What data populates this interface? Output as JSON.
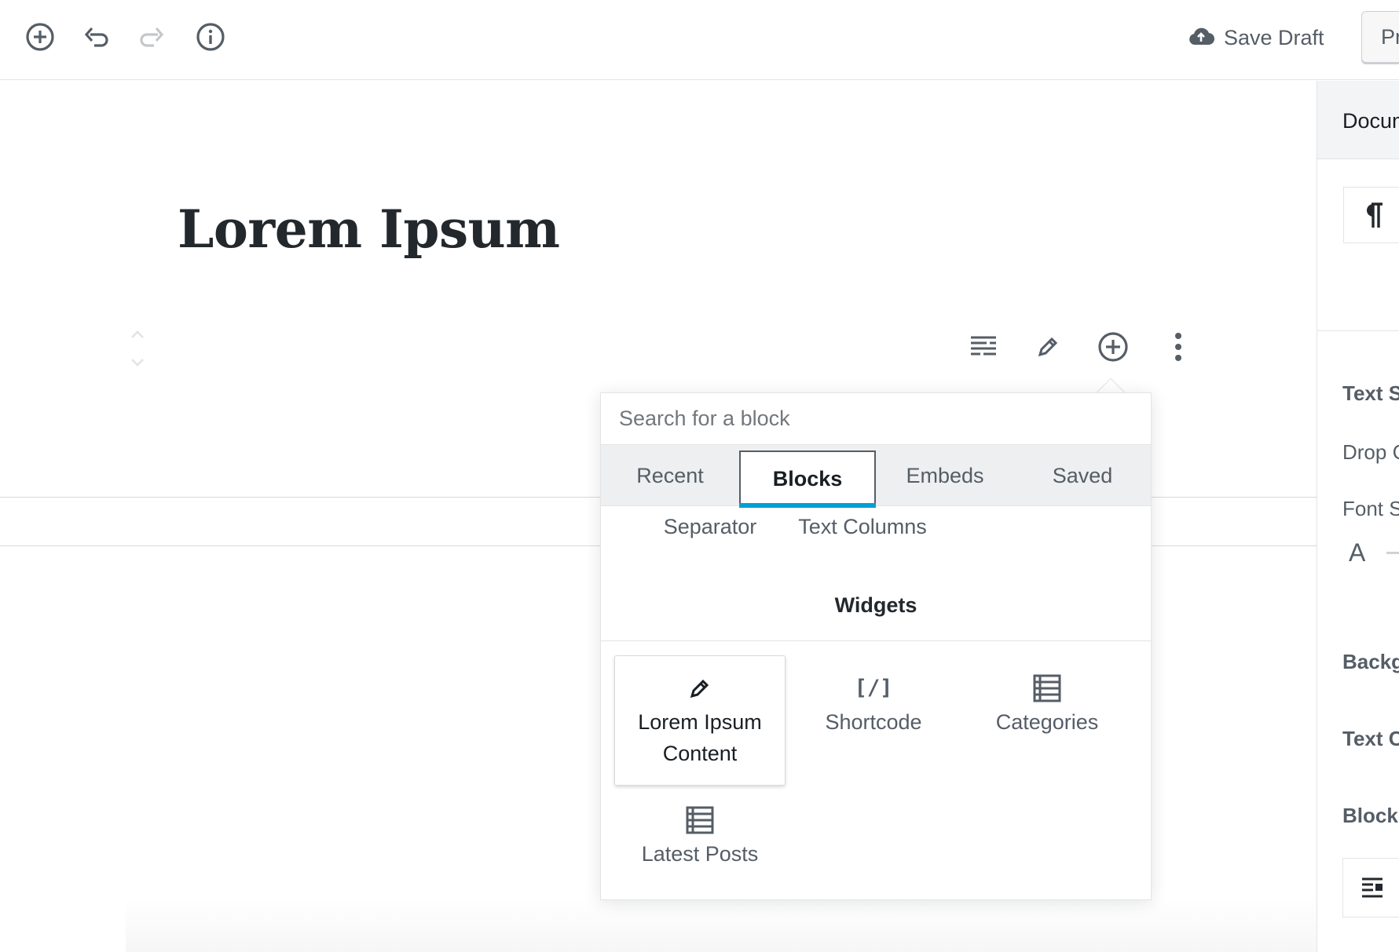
{
  "toolbar": {
    "add_block": "add-block-icon",
    "undo": "undo-icon",
    "redo": "redo-icon",
    "info": "info-icon",
    "save_draft_label": "Save Draft",
    "preview_label": "Pr"
  },
  "editor": {
    "title": "Lorem Ipsum"
  },
  "inserter": {
    "search_placeholder": "Search for a block",
    "tabs": [
      {
        "label": "Recent"
      },
      {
        "label": "Blocks"
      },
      {
        "label": "Embeds"
      },
      {
        "label": "Saved"
      }
    ],
    "active_tab": "Blocks",
    "layout_items": [
      "Separator",
      "Text Columns"
    ],
    "widgets_heading": "Widgets",
    "widgets": [
      {
        "line1": "Lorem Ipsum",
        "line2": "Content",
        "icon": "pencil-icon"
      },
      {
        "line1": "Shortcode",
        "icon": "shortcode-icon"
      },
      {
        "line1": "Categories",
        "icon": "list-icon"
      },
      {
        "line1": "Latest Posts",
        "icon": "list-icon"
      }
    ]
  },
  "sidebar": {
    "tab_label": "Docum",
    "text_settings": "Text S",
    "drop_cap": "Drop C",
    "font_size": "Font S",
    "font_size_glyph": "A",
    "background": "Backg",
    "text_color": "Text C",
    "block_alignment": "Block"
  },
  "colors": {
    "accent": "#00a0d2",
    "text": "#23282d",
    "muted": "#555d66",
    "border": "#e2e4e7"
  }
}
